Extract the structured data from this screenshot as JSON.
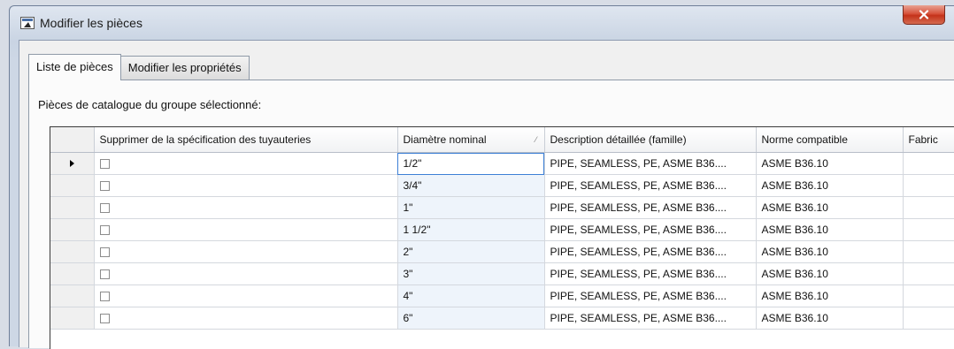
{
  "window": {
    "title": "Modifier les pièces",
    "close_glyph": "x"
  },
  "tabs": [
    {
      "label": "Liste de pièces",
      "active": true
    },
    {
      "label": "Modifier les propriétés",
      "active": false
    }
  ],
  "panel": {
    "label": "Pièces de catalogue du groupe sélectionné:"
  },
  "grid": {
    "columns": [
      {
        "label": ""
      },
      {
        "label": "Supprimer de la spécification des tuyauteries"
      },
      {
        "label": "Diamètre nominal"
      },
      {
        "label": "Description détaillée (famille)"
      },
      {
        "label": "Norme compatible"
      },
      {
        "label": "Fabric"
      }
    ],
    "sort_indicator": "⁄",
    "selected_row": 0,
    "rows": [
      {
        "remove": false,
        "diameter": "1/2\"",
        "description": "PIPE, SEAMLESS, PE, ASME B36....",
        "norm": "ASME B36.10",
        "fabric": ""
      },
      {
        "remove": false,
        "diameter": "3/4\"",
        "description": "PIPE, SEAMLESS, PE, ASME B36....",
        "norm": "ASME B36.10",
        "fabric": ""
      },
      {
        "remove": false,
        "diameter": "1\"",
        "description": "PIPE, SEAMLESS, PE, ASME B36....",
        "norm": "ASME B36.10",
        "fabric": ""
      },
      {
        "remove": false,
        "diameter": "1 1/2\"",
        "description": "PIPE, SEAMLESS, PE, ASME B36....",
        "norm": "ASME B36.10",
        "fabric": ""
      },
      {
        "remove": false,
        "diameter": "2\"",
        "description": "PIPE, SEAMLESS, PE, ASME B36....",
        "norm": "ASME B36.10",
        "fabric": ""
      },
      {
        "remove": false,
        "diameter": "3\"",
        "description": "PIPE, SEAMLESS, PE, ASME B36....",
        "norm": "ASME B36.10",
        "fabric": ""
      },
      {
        "remove": false,
        "diameter": "4\"",
        "description": "PIPE, SEAMLESS, PE, ASME B36....",
        "norm": "ASME B36.10",
        "fabric": ""
      },
      {
        "remove": false,
        "diameter": "6\"",
        "description": "PIPE, SEAMLESS, PE, ASME B36....",
        "norm": "ASME B36.10",
        "fabric": ""
      }
    ]
  }
}
